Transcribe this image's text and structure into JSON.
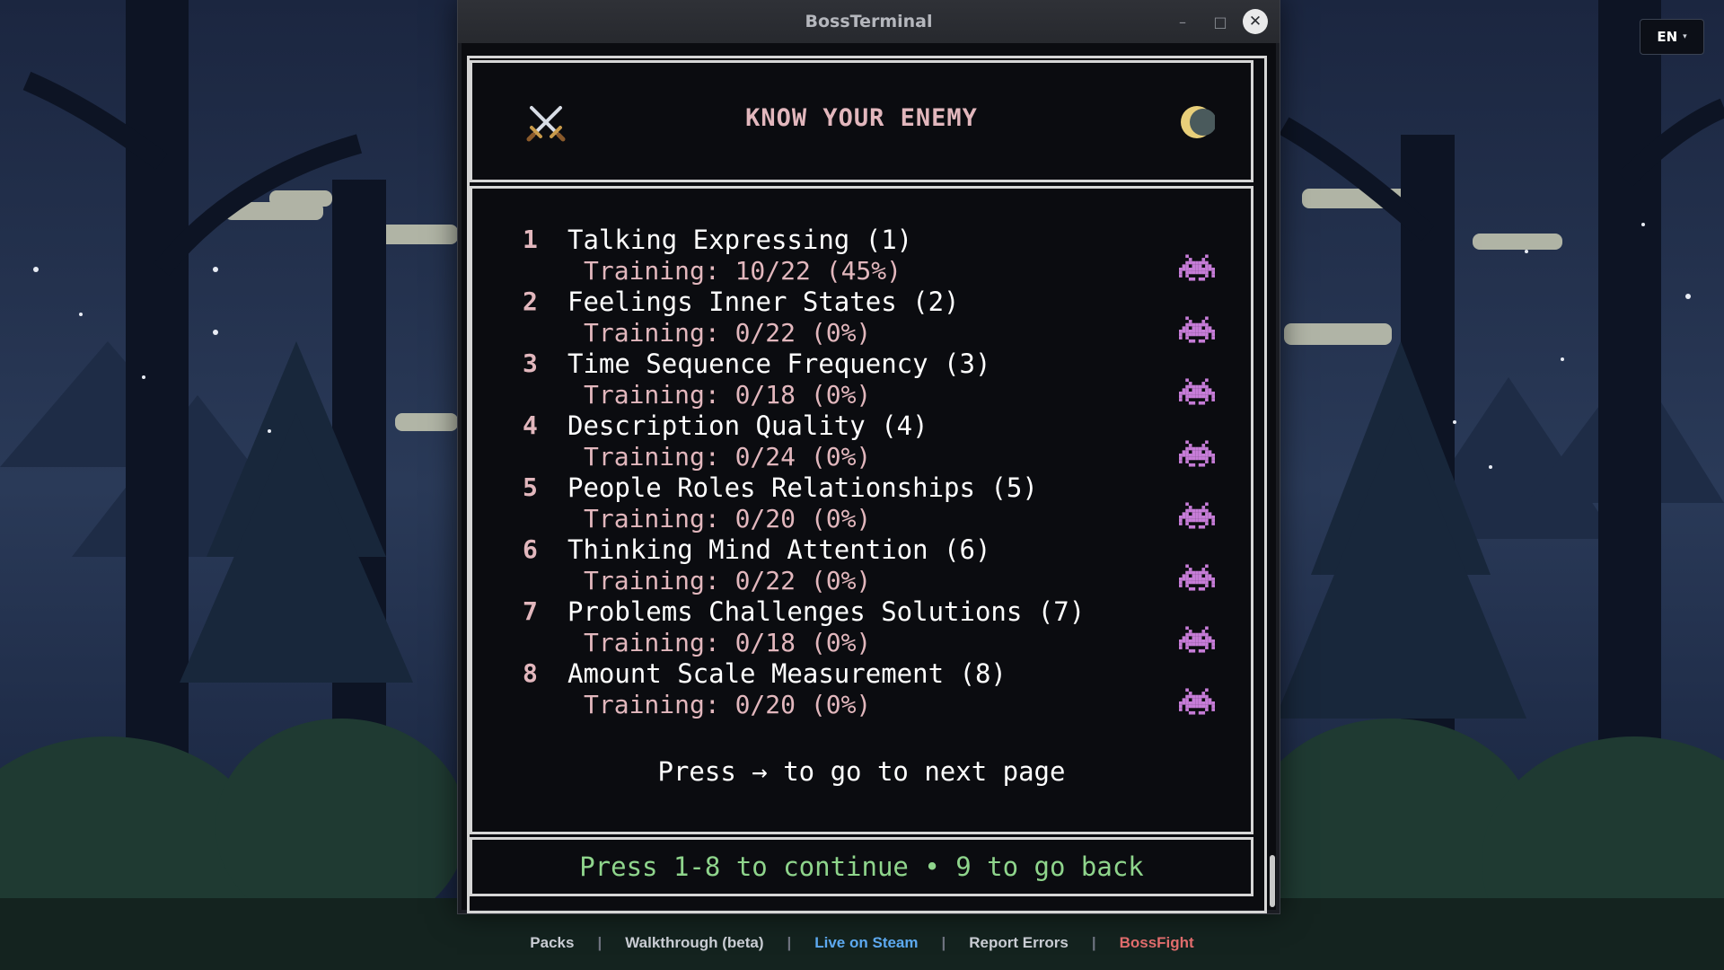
{
  "window": {
    "title": "BossTerminal",
    "minimize_label": "–",
    "maximize_label": "□",
    "close_label": "✕"
  },
  "language": {
    "selected": "EN",
    "caret": "▾"
  },
  "header": {
    "title": "KNOW YOUR ENEMY",
    "left_icon": "crossed-swords-icon",
    "right_icon": "crescent-moon-icon"
  },
  "topics": [
    {
      "number": "1",
      "title": "Talking Expressing (1)",
      "training": "Training: 10/22 (45%)",
      "progress": 0.45
    },
    {
      "number": "2",
      "title": "Feelings Inner States (2)",
      "training": "Training: 0/22 (0%)",
      "progress": 0
    },
    {
      "number": "3",
      "title": "Time Sequence Frequency (3)",
      "training": "Training: 0/18 (0%)",
      "progress": 0
    },
    {
      "number": "4",
      "title": "Description Quality (4)",
      "training": "Training: 0/24 (0%)",
      "progress": 0
    },
    {
      "number": "5",
      "title": "People Roles Relationships (5)",
      "training": "Training: 0/20 (0%)",
      "progress": 0
    },
    {
      "number": "6",
      "title": "Thinking Mind Attention (6)",
      "training": "Training: 0/22 (0%)",
      "progress": 0
    },
    {
      "number": "7",
      "title": "Problems Challenges Solutions (7)",
      "training": "Training: 0/18 (0%)",
      "progress": 0
    },
    {
      "number": "8",
      "title": "Amount Scale Measurement (8)",
      "training": "Training: 0/20 (0%)",
      "progress": 0
    }
  ],
  "next_page_hint": "Press → to go to next page",
  "footer_hint": "Press 1-8 to continue • 9 to go back",
  "nav": {
    "packs": "Packs",
    "walkthrough": "Walkthrough (beta)",
    "steam": "Live on Steam",
    "report": "Report Errors",
    "bossfight": "BossFight"
  },
  "colors": {
    "accent_pink": "#e2b7bd",
    "boss_purple": "#c77dd8",
    "footer_green": "#8fd58c",
    "steam_blue": "#5da9f0",
    "bossfight_red": "#e06c6c"
  }
}
